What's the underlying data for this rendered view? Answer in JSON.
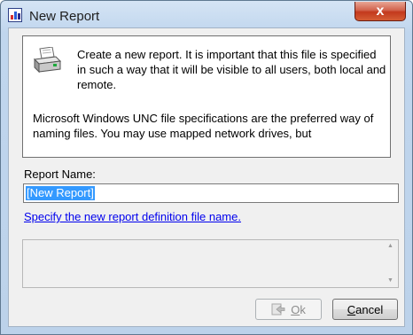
{
  "window": {
    "title": "New Report",
    "close_label": "x"
  },
  "info": {
    "intro": "Create a new report. It is important that this file is specified in such a way that it will be visible to all users, both local and remote.",
    "unc": "Microsoft Windows UNC file specifications are the preferred way of naming files. You may use mapped network drives, but"
  },
  "form": {
    "report_name_label": "Report Name:",
    "report_name_value": "[New Report]",
    "help_link": "Specify the new report definition file name."
  },
  "buttons": {
    "ok_first": "O",
    "ok_rest": "k",
    "cancel_first": "C",
    "cancel_rest": "ancel"
  },
  "icons": {
    "app": "report-app-icon",
    "info": "printer-icon",
    "ok": "ok-arrow-icon"
  }
}
